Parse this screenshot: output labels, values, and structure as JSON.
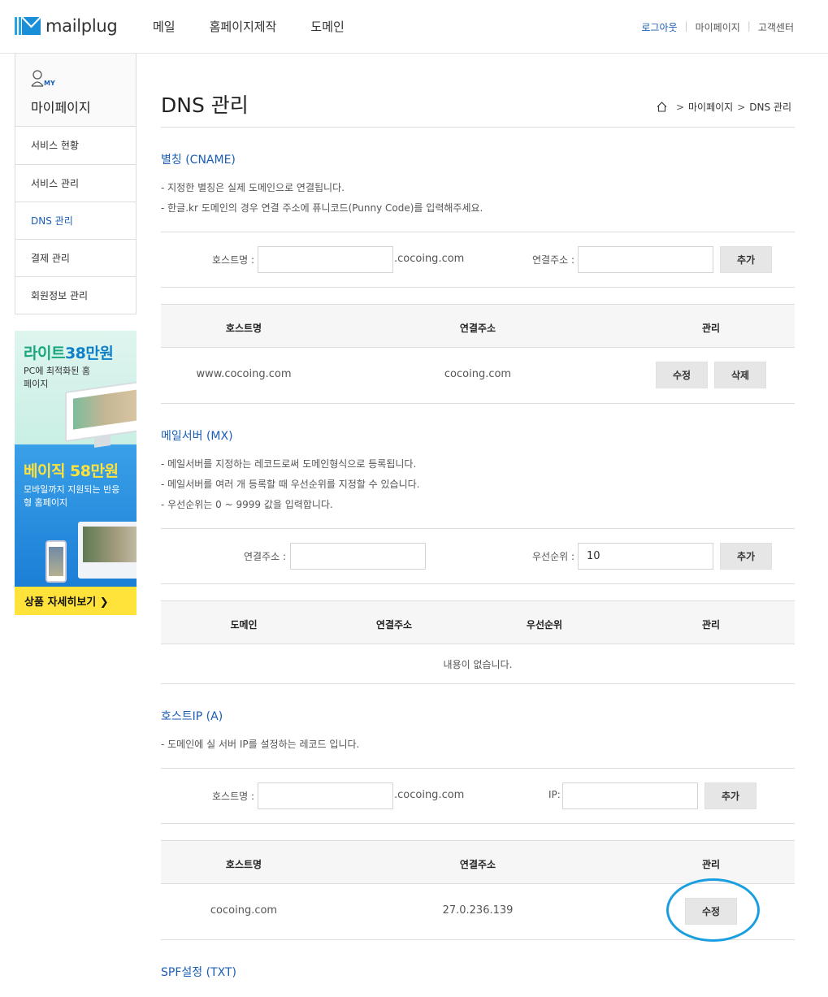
{
  "header": {
    "logo_text": "mailplug",
    "nav": [
      "메일",
      "홈페이지제작",
      "도메인"
    ],
    "util": {
      "logout": "로그아웃",
      "mypage": "마이페이지",
      "support": "고객센터"
    }
  },
  "sidebar": {
    "my_badge": "MY",
    "title": "마이페이지",
    "items": [
      {
        "label": "서비스 현황"
      },
      {
        "label": "서비스 관리"
      },
      {
        "label": "DNS 관리"
      },
      {
        "label": "결제 관리"
      },
      {
        "label": "회원정보 관리"
      }
    ],
    "banner": {
      "lite_title_a": "라이트",
      "lite_title_b": "38만원",
      "lite_sub": "PC에 최적화된 홈페이지",
      "basic_title": "베이직 58만원",
      "basic_sub": "모바일까지 지원되는 반응형 홈페이지",
      "cta": "상품 자세히보기 ❯"
    }
  },
  "page": {
    "title": "DNS 관리",
    "breadcrumb": [
      "마이페이지",
      "DNS 관리"
    ]
  },
  "cname": {
    "title": "별칭 (CNAME)",
    "desc": [
      "- 지정한 별칭은 실제 도메인으로 연결됩니다.",
      "- 한글.kr 도메인의 경우 연결 주소에 퓨니코드(Punny Code)를 입력해주세요."
    ],
    "host_label": "호스트명 :",
    "host_value": "",
    "suffix": ".cocoing.com",
    "target_label": "연결주소 :",
    "target_value": "",
    "add": "추가",
    "headers": [
      "호스트명",
      "연결주소",
      "관리"
    ],
    "rows": [
      {
        "host": "www.cocoing.com",
        "target": "cocoing.com",
        "edit": "수정",
        "delete": "삭제"
      }
    ]
  },
  "mx": {
    "title": "메일서버 (MX)",
    "desc": [
      "- 메일서버를 지정하는 레코드로써 도메인형식으로 등록됩니다.",
      "- 메일서버를 여러 개 등록할 때 우선순위를 지정할 수 있습니다.",
      "- 우선순위는 0 ~ 9999 값을 입력합니다."
    ],
    "target_label": "연결주소 :",
    "target_value": "",
    "priority_label": "우선순위 :",
    "priority_value": "10",
    "add": "추가",
    "headers": [
      "도메인",
      "연결주소",
      "우선순위",
      "관리"
    ],
    "empty": "내용이 없습니다."
  },
  "a": {
    "title": "호스트IP (A)",
    "desc": [
      "- 도메인에 실 서버 IP를 설정하는 레코드 입니다."
    ],
    "host_label": "호스트명 :",
    "host_value": "",
    "suffix": ".cocoing.com",
    "ip_label": "IP:",
    "ip_value": "",
    "add": "추가",
    "headers": [
      "호스트명",
      "연결주소",
      "관리"
    ],
    "rows": [
      {
        "host": "cocoing.com",
        "target": "27.0.236.139",
        "edit": "수정"
      }
    ]
  },
  "spf": {
    "title": "SPF설정 (TXT)"
  },
  "colors": {
    "accent": "#1a5db5",
    "highlight": "#1a9ee0"
  }
}
